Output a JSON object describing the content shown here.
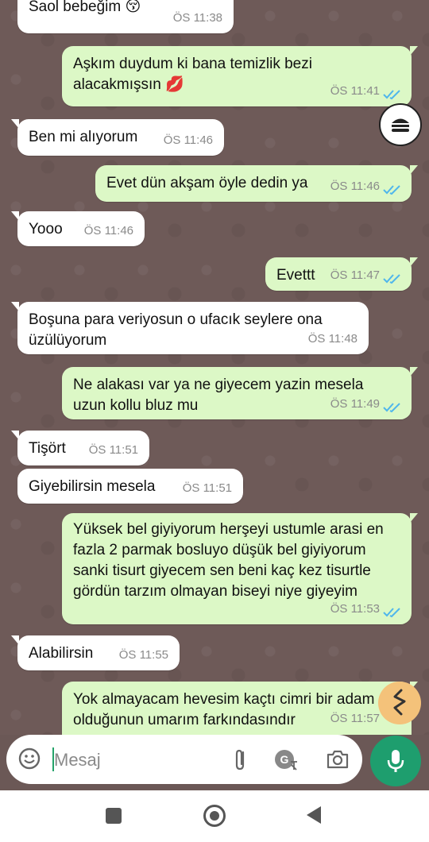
{
  "messages": [
    {
      "dir": "in",
      "text": "Saol bebeğim",
      "emoji": "😚",
      "time": "ÖS 11:38"
    },
    {
      "dir": "out",
      "text": "Aşkım duydum ki bana temizlik bezi alacakmışsın",
      "emoji": "💋",
      "time": "ÖS 11:41"
    },
    {
      "dir": "in",
      "text": "Ben mi alıyorum",
      "time": "ÖS 11:46"
    },
    {
      "dir": "out",
      "text": "Evet dün akşam öyle dedin ya",
      "time": "ÖS 11:46"
    },
    {
      "dir": "in",
      "text": "Yooo",
      "time": "ÖS 11:46"
    },
    {
      "dir": "out",
      "text": "Evettt",
      "time": "ÖS 11:47"
    },
    {
      "dir": "in",
      "text": "Boşuna para veriyosun o ufacık seylere ona üzülüyorum",
      "time": "ÖS 11:48"
    },
    {
      "dir": "out",
      "text": "Ne alakası var ya ne giyecem yazin mesela uzun kollu bluz mu",
      "time": "ÖS 11:49"
    },
    {
      "dir": "in",
      "text": "Tişört",
      "time": "ÖS 11:51"
    },
    {
      "dir": "in",
      "text": "Giyebilirsin mesela",
      "time": "ÖS 11:51"
    },
    {
      "dir": "out",
      "text": "Yüksek bel giyiyorum herşeyi ustumle arasi en fazla 2 parmak bosluyo düşük bel giyiyorum sanki tisurt giyecem sen beni kaç kez tisurtle gördün tarzım olmayan biseyi niye giyeyim",
      "time": "ÖS 11:53"
    },
    {
      "dir": "in",
      "text": "Alabilirsin",
      "time": "ÖS 11:55"
    },
    {
      "dir": "out",
      "text": "Yok almayacam hevesim kaçtı cimri bir adam olduğunun umarım farkındasındır",
      "time": "ÖS 11:57"
    }
  ],
  "composer": {
    "placeholder": "Mesaj"
  },
  "icons": {
    "emoji": "emoji-icon",
    "attach": "paperclip-icon",
    "translate": "translate-icon",
    "camera": "camera-icon",
    "mic": "microphone-icon",
    "burger": "burger-icon",
    "yellow": "squiggle-icon"
  },
  "colors": {
    "incoming": "#ffffff",
    "outgoing": "#dcf8c6",
    "tick": "#4fb6ec",
    "accent": "#1e9e6e"
  }
}
